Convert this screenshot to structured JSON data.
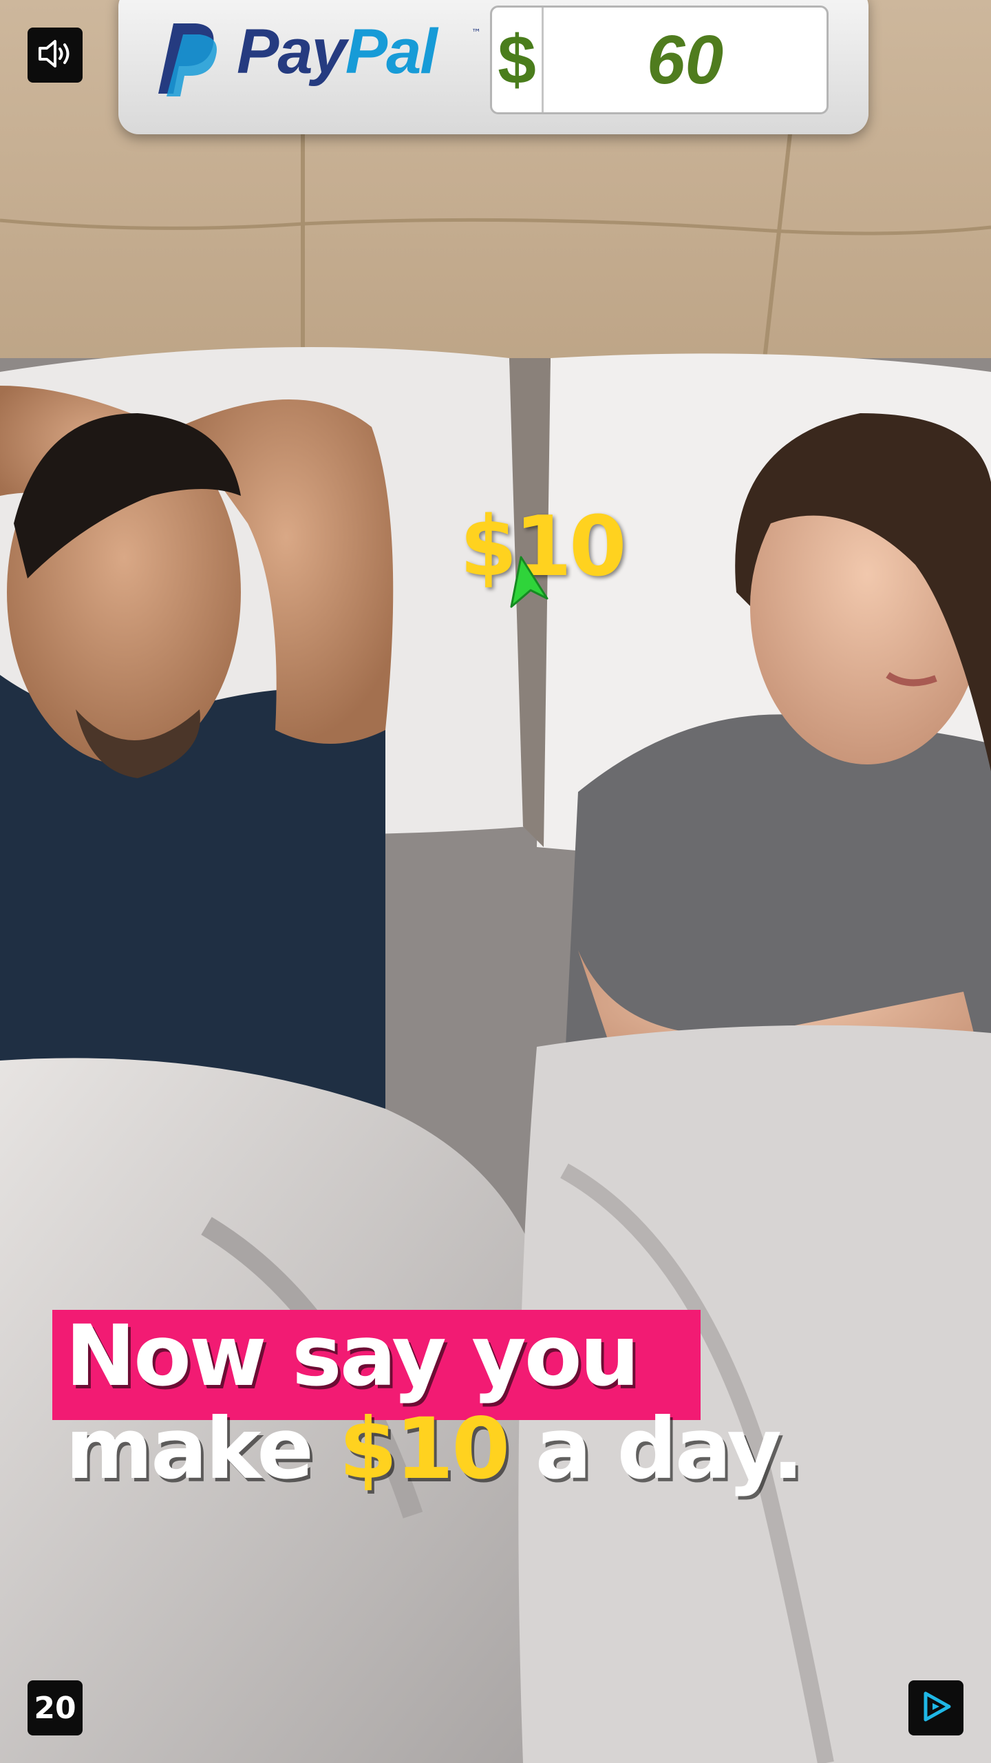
{
  "video": {
    "description_icon": "speaker-icon"
  },
  "banner": {
    "brand_pay": "Pay",
    "brand_pal": "Pal",
    "brand_tm": "™",
    "currency_symbol": "$",
    "amount": "60",
    "logo_icon": "paypal-logo-icon",
    "colors": {
      "pay": "#253b80",
      "pal": "#179bd7",
      "amount": "#4f7c1e"
    }
  },
  "overlay": {
    "floating_amount": "$10",
    "cursor_icon": "pointer-arrow-icon"
  },
  "caption": {
    "line1": "Now say you",
    "line2_prefix": "make ",
    "line2_highlight": "$10",
    "line2_suffix": " a day.",
    "highlight_color": "#ffd21f",
    "band_color": "#f21b73"
  },
  "controls": {
    "counter": "20",
    "mute_icon": "speaker-icon",
    "play_icon": "play-icon"
  }
}
